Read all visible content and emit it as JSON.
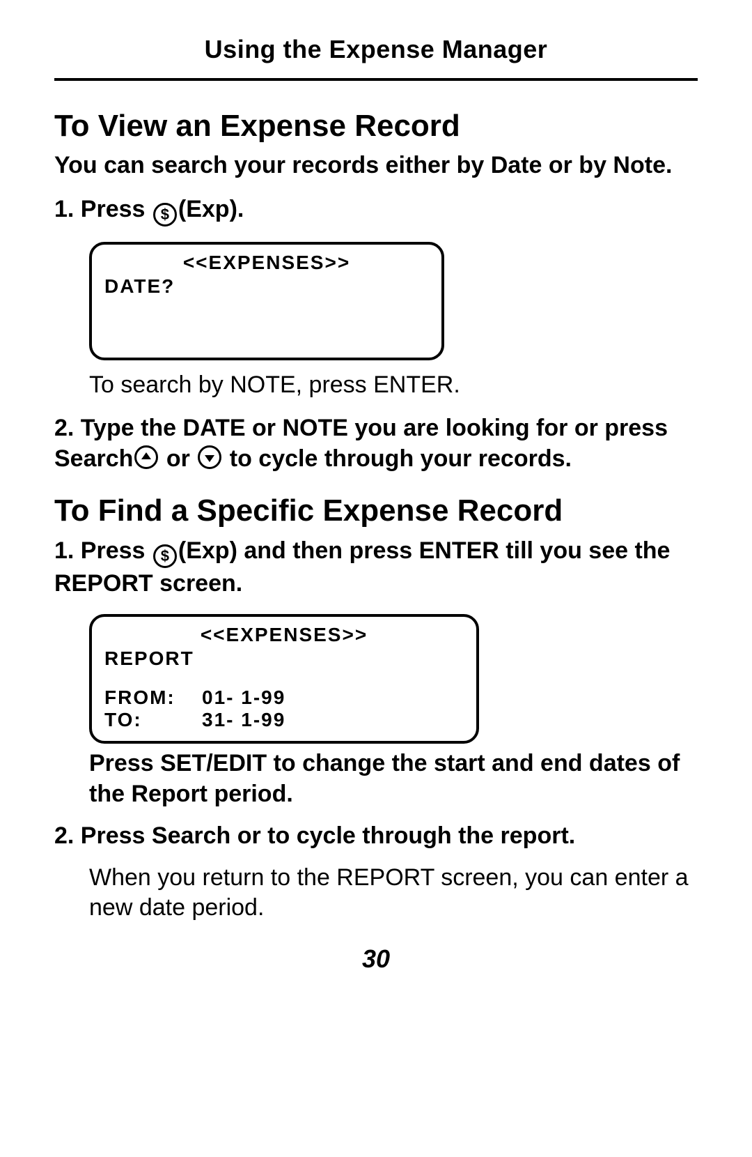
{
  "header": "Using the Expense Manager",
  "section1": {
    "heading": "To View an Expense Record",
    "intro": "You can search your records either by Date or by Note.",
    "step1_a": "1. Press ",
    "step1_b": "(Exp).",
    "screen": {
      "title": "<<EXPENSES>>",
      "line1": "DATE?"
    },
    "after_screen": "To search by NOTE, press ENTER.",
    "step2_a": "2. Type the DATE or NOTE you are looking for or press Search",
    "step2_b": " or ",
    "step2_c": " to cycle through your records."
  },
  "section2": {
    "heading": "To Find a Specific Expense Record",
    "step1_a": "1. Press ",
    "step1_b": "(Exp) and then press ENTER till you see the REPORT screen.",
    "screen": {
      "title": "<<EXPENSES>>",
      "line1": "REPORT",
      "from_label": "FROM:",
      "from_value": "01- 1-99",
      "to_label": "TO:",
      "to_value": "31- 1-99"
    },
    "after_screen": "Press SET/EDIT to change the start and end dates of the Report period.",
    "step2": "2. Press Search or  to cycle through the report.",
    "step2_note": "When you return to the REPORT screen, you can enter a new date period."
  },
  "page_number": "30",
  "icons": {
    "dollar": "$"
  }
}
